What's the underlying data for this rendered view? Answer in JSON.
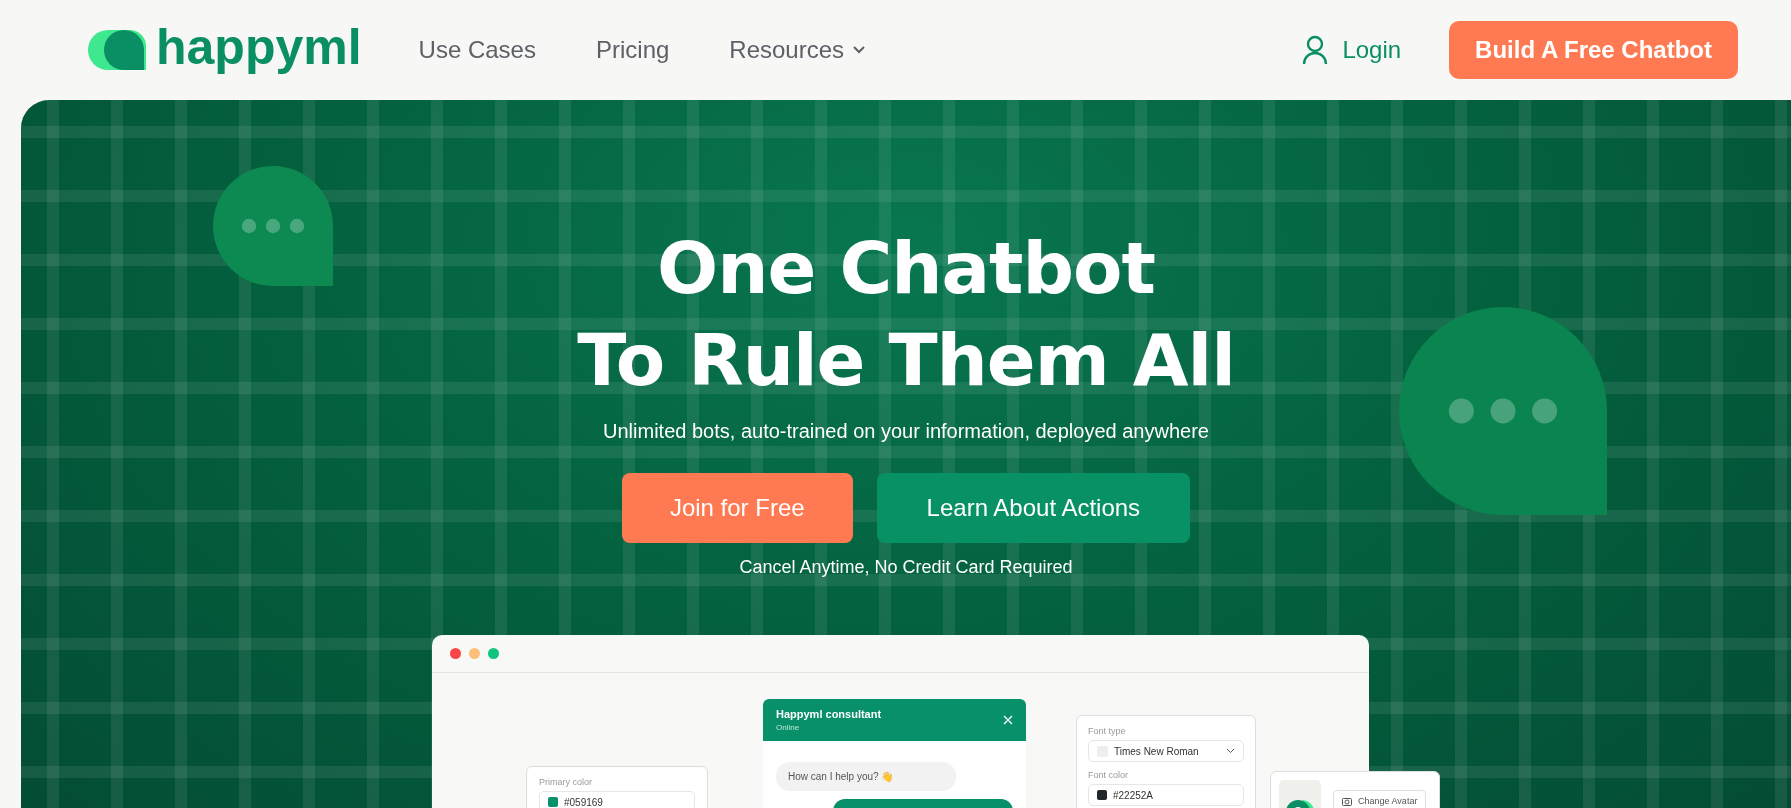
{
  "nav": {
    "logo": "happyml",
    "links": [
      {
        "label": "Use Cases",
        "dropdown": false
      },
      {
        "label": "Pricing",
        "dropdown": false
      },
      {
        "label": "Resources",
        "dropdown": true
      }
    ],
    "login": "Login",
    "cta": "Build A Free Chatbot"
  },
  "hero": {
    "title_lines": [
      "One Chatbot",
      "To Rule Them All"
    ],
    "subtitle": "Unlimited bots, auto-trained on your information, deployed anywhere",
    "buttons": [
      {
        "label": "Join for Free",
        "kind": "primary"
      },
      {
        "label": "Learn About Actions",
        "kind": "secondary"
      }
    ],
    "note": "Cancel Anytime, No Credit Card Required"
  },
  "mockup": {
    "primary_color": {
      "label": "Primary color",
      "value": "#059169",
      "color": "#059169"
    },
    "chat": {
      "title": "Happyml consultant",
      "status": "Online",
      "message": "How can I help you? 👋"
    },
    "font": {
      "type_label": "Font type",
      "type_value": "Times New Roman",
      "color_label": "Font color",
      "color_value": "#22252A",
      "color": "#22252a"
    },
    "avatar": {
      "button": "Change Avatar"
    }
  }
}
